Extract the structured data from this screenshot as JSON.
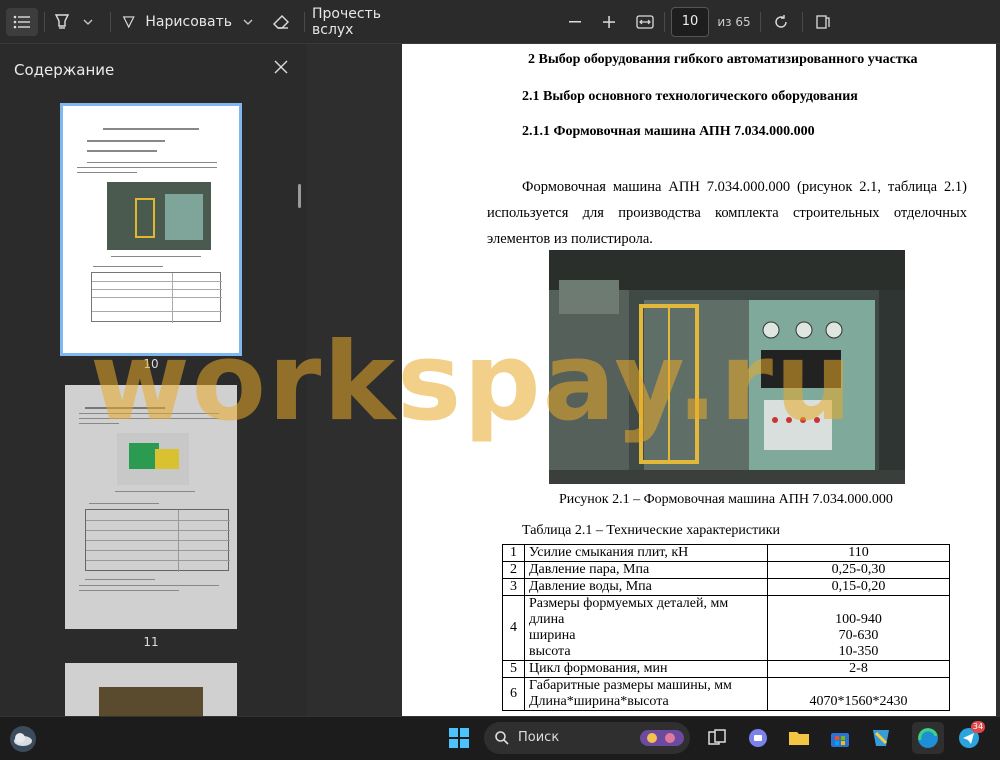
{
  "toolbar": {
    "draw_label": "Нарисовать",
    "read_aloud_label": "Прочесть вслух",
    "page_input": "10",
    "page_total": "из 65"
  },
  "sidebar": {
    "title": "Содержание",
    "thumbs": [
      {
        "page": "10"
      },
      {
        "page": "11"
      }
    ]
  },
  "document": {
    "heading2": "2 Выбор оборудования гибкого автоматизированного участка",
    "heading21": "2.1 Выбор основного технологического оборудования",
    "heading211": "2.1.1 Формовочная машина АПН 7.034.000.000",
    "paragraph": "Формовочная машина АПН 7.034.000.000 (рисунок 2.1, таблица 2.1) используется для производства комплекта строительных отделочных элементов из полистирола.",
    "figure_caption": "Рисунок 2.1 – Формовочная машина АПН 7.034.000.000",
    "table_caption": "Таблица 2.1 – Технические характеристики",
    "table_rows": [
      {
        "n": "1",
        "name": "Усилие смыкания плит, кН",
        "value": "110"
      },
      {
        "n": "2",
        "name": "Давление пара, Мпа",
        "value": "0,25-0,30"
      },
      {
        "n": "3",
        "name": "Давление воды, Мпа",
        "value": "0,15-0,20"
      },
      {
        "n": "4",
        "name": "Размеры формуемых деталей, мм",
        "sub": [
          "длина",
          "ширина",
          "высота"
        ],
        "subvals": [
          "100-940",
          "70-630",
          "10-350"
        ]
      },
      {
        "n": "5",
        "name": "Цикл формования, мин",
        "value": "2-8"
      },
      {
        "n": "6",
        "name": "Габаритные размеры машины, мм",
        "sub": [
          "Длина*ширина*высота"
        ],
        "subvals": [
          "4070*1560*2430"
        ]
      }
    ]
  },
  "watermark": "workspay.ru",
  "taskbar": {
    "search_placeholder": "Поиск",
    "telegram_badge": "34"
  },
  "colors": {
    "accent": "#7fb8f0",
    "watermark": "#e8aa28"
  }
}
